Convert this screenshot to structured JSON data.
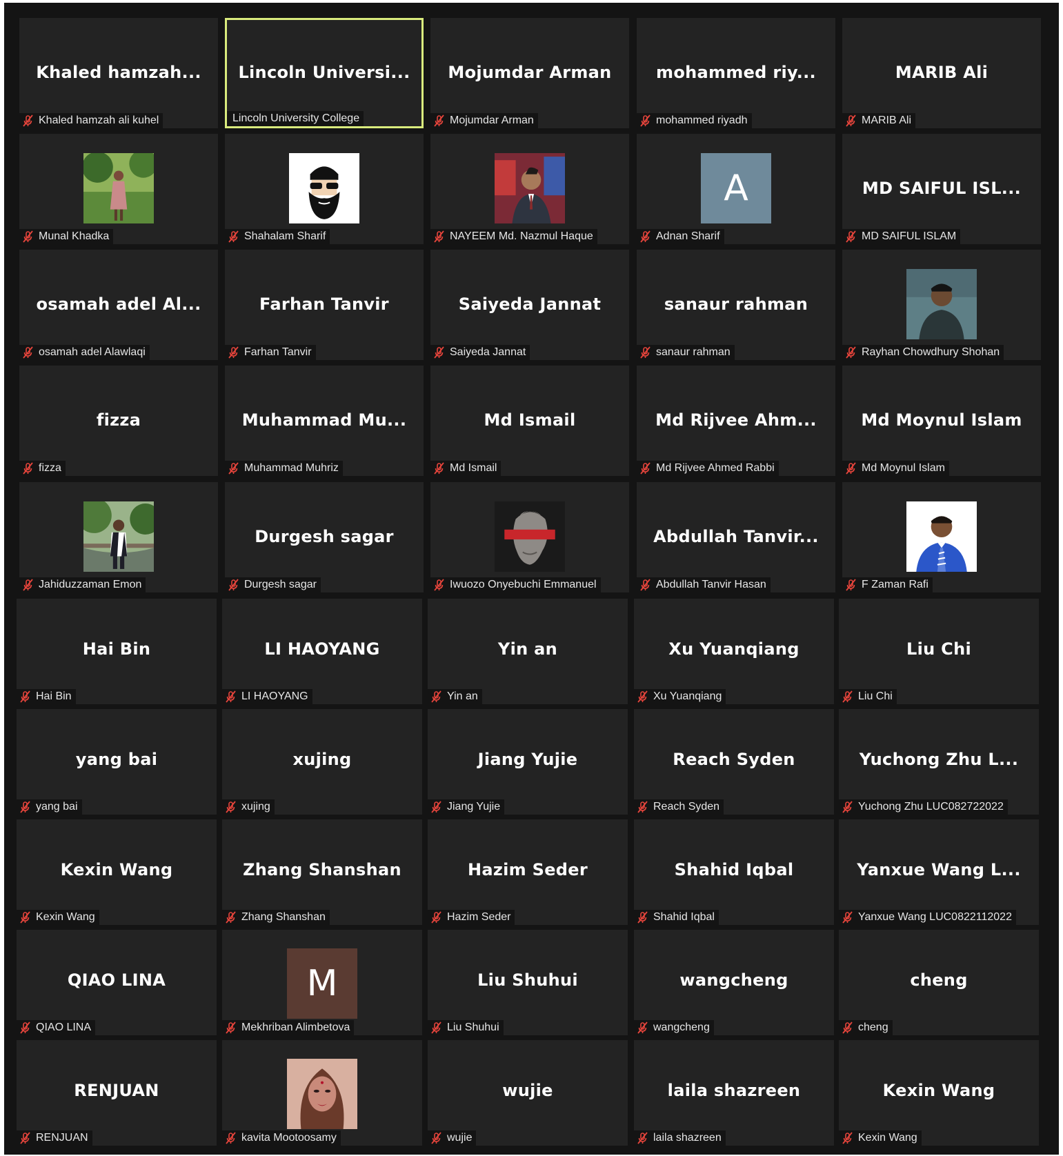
{
  "meeting": {
    "participants": [
      {
        "display": "Khaled  hamzah...",
        "label": "Khaled hamzah ali kuhel"
      },
      {
        "display": "Lincoln  Universi...",
        "label": "Lincoln University College",
        "active": true
      },
      {
        "display": "Mojumdar Arman",
        "label": "Mojumdar Arman"
      },
      {
        "display": "mohammed  riy...",
        "label": "mohammed riyadh"
      },
      {
        "display": "MARIB Ali",
        "label": "MARIB Ali"
      },
      {
        "label": "Munal Khadka",
        "avatar": "photo",
        "avatar_icon": "person-in-park-photo",
        "avatar_colors": [
          "#5c8a3a",
          "#8fb25a"
        ]
      },
      {
        "label": "Shahalam Sharif",
        "avatar": "photo",
        "avatar_icon": "bearded-man-sunglasses-cartoon",
        "avatar_colors": [
          "#ffffff",
          "#111111"
        ]
      },
      {
        "label": "NAYEEM Md. Nazmul Haque",
        "avatar": "photo",
        "avatar_icon": "man-in-suit-photo",
        "avatar_colors": [
          "#7b2a36",
          "#2e3440"
        ]
      },
      {
        "label": "Adnan Sharif",
        "avatar": "letter",
        "letter": "A",
        "avatar_colors": [
          "#6f8a9b",
          "#6f8a9b"
        ]
      },
      {
        "display": "MD SAIFUL ISL...",
        "label": "MD SAIFUL ISLAM"
      },
      {
        "display": "osamah  adel  Al...",
        "label": "osamah adel Alawlaqi"
      },
      {
        "display": "Farhan Tanvir",
        "label": "Farhan Tanvir"
      },
      {
        "display": "Saiyeda Jannat",
        "label": "Saiyeda Jannat"
      },
      {
        "display": "sanaur rahman",
        "label": "sanaur rahman"
      },
      {
        "label": "Rayhan Chowdhury Shohan",
        "avatar": "photo",
        "avatar_icon": "man-by-water-photo",
        "avatar_colors": [
          "#4f6b73",
          "#2a3638"
        ]
      },
      {
        "display": "fizza",
        "label": "fizza"
      },
      {
        "display": "Muhammad  Mu...",
        "label": "Muhammad Muhriz"
      },
      {
        "display": "Md Ismail",
        "label": "Md Ismail"
      },
      {
        "display": "Md  Rijvee  Ahm...",
        "label": "Md Rijvee Ahmed Rabbi"
      },
      {
        "display": "Md Moynul Islam",
        "label": "Md Moynul Islam"
      },
      {
        "label": "Jahiduzzaman Emon",
        "avatar": "photo",
        "avatar_icon": "man-on-bridge-photo",
        "avatar_colors": [
          "#4f7a3a",
          "#9ab38a"
        ]
      },
      {
        "display": "Durgesh sagar",
        "label": "Durgesh sagar"
      },
      {
        "label": "Iwuozo Onyebuchi Emmanuel",
        "avatar": "photo",
        "avatar_icon": "statue-red-band-photo",
        "avatar_colors": [
          "#1a1a1a",
          "#c8262b"
        ]
      },
      {
        "display": "Abdullah  Tanvir...",
        "label": "Abdullah Tanvir Hasan"
      },
      {
        "label": "F Zaman Rafi",
        "avatar": "photo",
        "avatar_icon": "man-blue-shirt-photo",
        "avatar_colors": [
          "#ffffff",
          "#2b57c9"
        ]
      },
      {
        "display": "Hai Bin",
        "label": "Hai Bin"
      },
      {
        "display": "LI HAOYANG",
        "label": "LI HAOYANG"
      },
      {
        "display": "Yin an",
        "label": "Yin an"
      },
      {
        "display": "Xu Yuanqiang",
        "label": "Xu Yuanqiang"
      },
      {
        "display": "Liu Chi",
        "label": "Liu Chi"
      },
      {
        "display": "yang bai",
        "label": "yang bai"
      },
      {
        "display": "xujing",
        "label": "xujing"
      },
      {
        "display": "Jiang Yujie",
        "label": "Jiang Yujie"
      },
      {
        "display": "Reach Syden",
        "label": "Reach Syden"
      },
      {
        "display": "Yuchong Zhu L...",
        "label": "Yuchong Zhu LUC082722022"
      },
      {
        "display": "Kexin Wang",
        "label": "Kexin Wang"
      },
      {
        "display": "Zhang Shanshan",
        "label": "Zhang Shanshan"
      },
      {
        "display": "Hazim Seder",
        "label": "Hazim Seder"
      },
      {
        "display": "Shahid Iqbal",
        "label": "Shahid Iqbal"
      },
      {
        "display": "Yanxue Wang L...",
        "label": "Yanxue Wang LUC0822112022"
      },
      {
        "display": "QIAO LINA",
        "label": "QIAO LINA"
      },
      {
        "label": "Mekhriban Alimbetova",
        "avatar": "letter",
        "letter": "M",
        "avatar_colors": [
          "#5a3b32",
          "#5a3b32"
        ]
      },
      {
        "display": "Liu Shuhui",
        "label": "Liu Shuhui"
      },
      {
        "display": "wangcheng",
        "label": "wangcheng"
      },
      {
        "display": "cheng",
        "label": "cheng"
      },
      {
        "display": "RENJUAN",
        "label": "RENJUAN"
      },
      {
        "label": "kavita Mootoosamy",
        "avatar": "photo",
        "avatar_icon": "woman-portrait-photo",
        "avatar_colors": [
          "#c98a7a",
          "#6a3a2a"
        ]
      },
      {
        "display": "wujie",
        "label": "wujie"
      },
      {
        "display": "laila shazreen",
        "label": "laila shazreen"
      },
      {
        "display": "Kexin Wang",
        "label": "Kexin Wang"
      }
    ],
    "muted_icon": "microphone-muted-icon",
    "colors": {
      "tile_bg": "#232323",
      "active_border": "#d9eb7d",
      "muted_icon": "#e8453c",
      "text": "#ffffff"
    }
  }
}
